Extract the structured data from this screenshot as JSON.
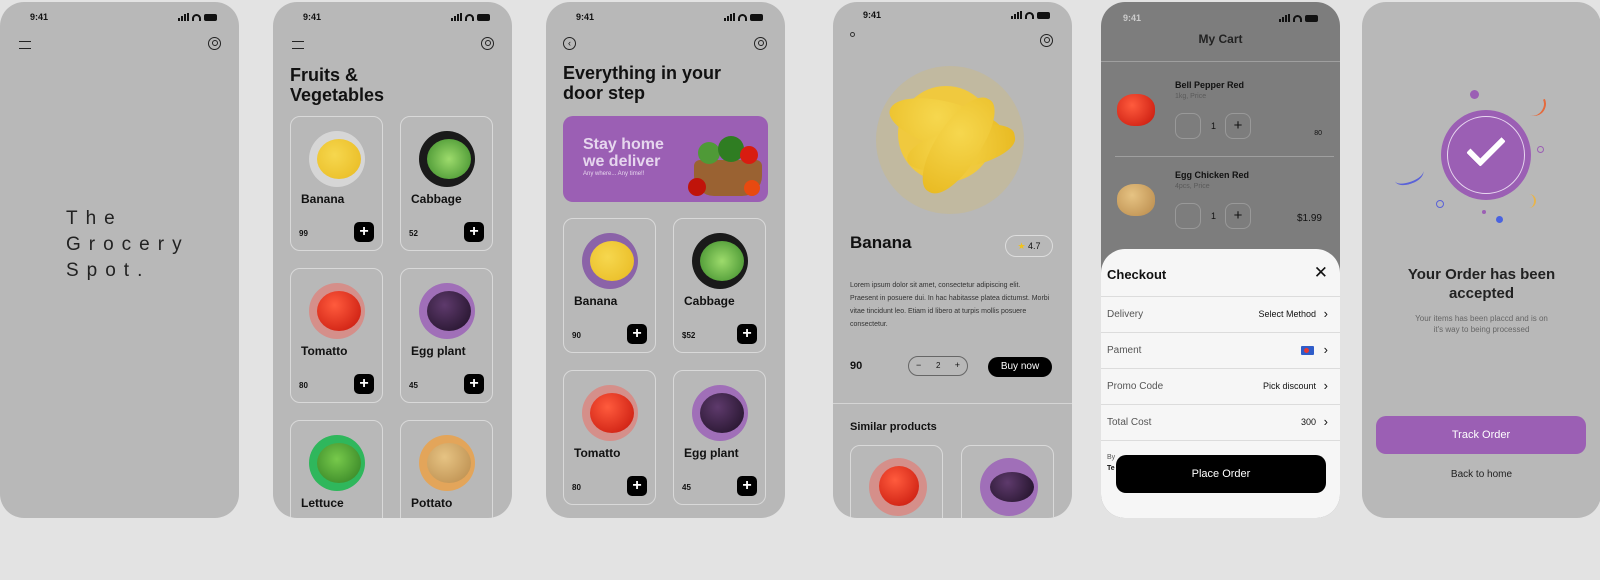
{
  "status": {
    "time": "9:41"
  },
  "splash": {
    "title_lines": [
      "The",
      "Grocery",
      "Spot."
    ]
  },
  "fruits_screen": {
    "title_line1": "Fruits &",
    "title_line2": "Vegetables",
    "items": [
      {
        "name": "Banana",
        "price": "99",
        "kind": "banana",
        "ring": "#d6d6d6"
      },
      {
        "name": "Cabbage",
        "price": "52",
        "kind": "cabbage",
        "ring": "#1a1a1a"
      },
      {
        "name": "Tomatto",
        "price": "80",
        "kind": "tomato",
        "ring": "#d58f8a"
      },
      {
        "name": "Egg plant",
        "price": "45",
        "kind": "eggplant",
        "ring": "#a06fb8"
      },
      {
        "name": "Lettuce",
        "price": "",
        "kind": "lettuce",
        "ring": "#2fb75c"
      },
      {
        "name": "Pottato",
        "price": "",
        "kind": "potato",
        "ring": "#e3a55a"
      }
    ]
  },
  "home_screen": {
    "title_line1": "Everything in your",
    "title_line2": "door step",
    "banner_line1": "Stay home",
    "banner_line2": "we deliver",
    "banner_sub": "Any where... Any time!!",
    "items": [
      {
        "name": "Banana",
        "price": "90",
        "kind": "banana",
        "ring": "#8b63a8"
      },
      {
        "name": "Cabbage",
        "price": "$52",
        "kind": "cabbage",
        "ring": "#1a1a1a"
      },
      {
        "name": "Tomatto",
        "price": "80",
        "kind": "tomato",
        "ring": "#d58f8a"
      },
      {
        "name": "Egg plant",
        "price": "45",
        "kind": "eggplant",
        "ring": "#a06fb8"
      }
    ]
  },
  "detail_screen": {
    "name": "Banana",
    "rating": "4.7",
    "description": "Lorem ipsum dolor sit amet, consectetur adipiscing elit. Praesent in posuere dui. In hac habitasse platea dictumst. Morbi vitae tincidunt leo. Etiam id libero at turpis mollis posuere consectetur.",
    "price": "90",
    "qty": "2",
    "buy_label": "Buy now",
    "similar_label": "Similar products"
  },
  "cart_screen": {
    "title": "My Cart",
    "items": [
      {
        "name": "Bell Pepper Red",
        "sub": "1kg, Price",
        "qty": "1",
        "price": "80",
        "kind": "tomato"
      },
      {
        "name": "Egg Chicken Red",
        "sub": "4pcs, Price",
        "qty": "1",
        "price": "$1.99",
        "kind": "potato"
      }
    ],
    "checkout": {
      "title": "Checkout",
      "rows": [
        {
          "label": "Delivery",
          "value": "Select Method"
        },
        {
          "label": "Pament",
          "value": ""
        },
        {
          "label": "Promo Code",
          "value": "Pick discount"
        },
        {
          "label": "Total Cost",
          "value": "300"
        }
      ],
      "terms_prefix": "By",
      "terms_link": "Te",
      "place_label": "Place Order"
    }
  },
  "accepted_screen": {
    "title_line1": "Your Order has been",
    "title_line2": "accepted",
    "sub_line1": "Your items has been placcd and is on",
    "sub_line2": "it's way to being processed",
    "track_label": "Track Order",
    "home_label": "Back to home"
  },
  "colors": {
    "accent": "#9b5fb4",
    "phone_bg": "#b8b8b8",
    "page_bg": "#e3e3e3"
  }
}
